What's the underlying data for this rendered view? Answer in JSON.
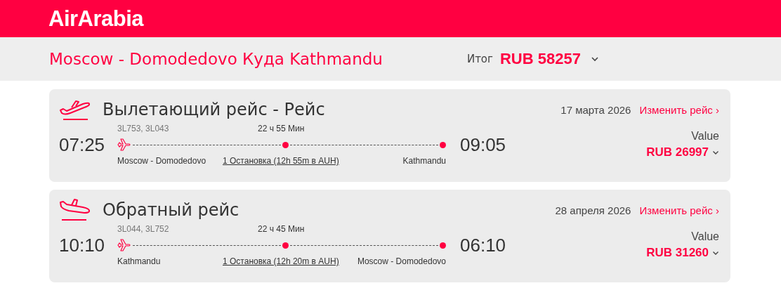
{
  "header": {
    "logo": "AirArabia"
  },
  "summary": {
    "route": "Moscow - Domodedovo Куда Kathmandu",
    "total_label": "Итог",
    "total": "RUB 58257"
  },
  "flights": [
    {
      "kind": "departure",
      "title": "Вылетающий рейс - Рейс",
      "date": "17 марта 2026",
      "change": "Изменить рейс ›",
      "flight_numbers": "3L753, 3L043",
      "duration": "22 ч 55 Мин",
      "depart_time": "07:25",
      "arrive_time": "09:05",
      "origin": "Moscow - Domodedovo",
      "stops": "1 Остановка (12h 55m в AUH)",
      "destination": "Kathmandu",
      "fare": "Value",
      "price": "RUB 26997"
    },
    {
      "kind": "return",
      "title": "Обратный рейс",
      "date": "28 апреля 2026",
      "change": "Изменить рейс ›",
      "flight_numbers": "3L044, 3L752",
      "duration": "22 ч 45 Мин",
      "depart_time": "10:10",
      "arrive_time": "06:10",
      "origin": "Kathmandu",
      "stops": "1 Остановка (12h 20m в AUH)",
      "destination": "Moscow - Domodedovo",
      "fare": "Value",
      "price": "RUB 31260"
    }
  ]
}
